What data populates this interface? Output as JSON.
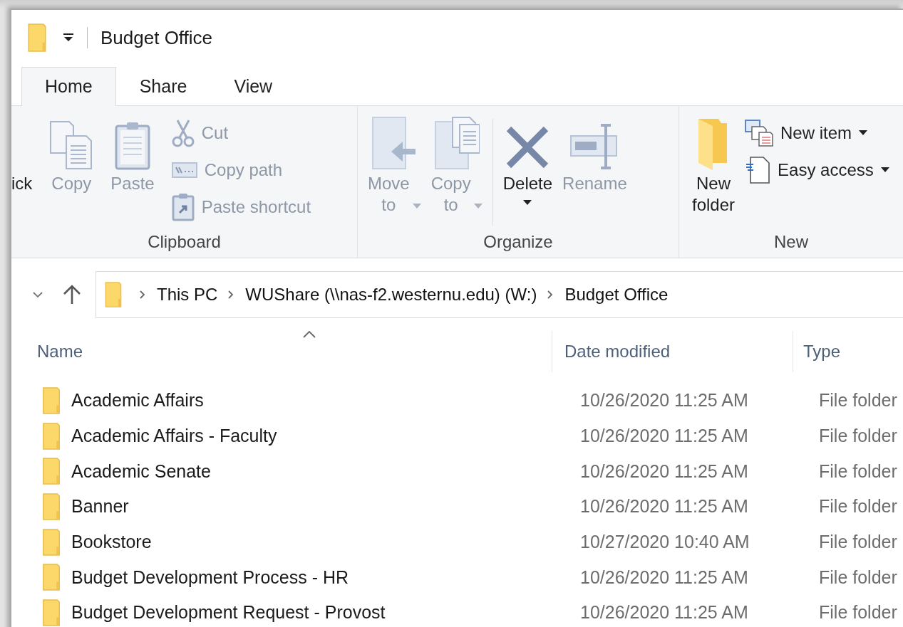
{
  "window": {
    "title": "Budget Office"
  },
  "tabs": [
    {
      "label": "Home",
      "selected": true
    },
    {
      "label": "Share",
      "selected": false
    },
    {
      "label": "View",
      "selected": false
    }
  ],
  "ribbon": {
    "groups": [
      {
        "label": "Clipboard",
        "items": [
          {
            "kind": "partial",
            "label": "ick",
            "disabled": false
          },
          {
            "kind": "large",
            "label": "Copy",
            "disabled": true,
            "dropdown": false
          },
          {
            "kind": "large",
            "label": "Paste",
            "disabled": true,
            "dropdown": false
          },
          {
            "kind": "small",
            "label": "Cut",
            "disabled": true,
            "dropdown": false
          },
          {
            "kind": "small",
            "label": "Copy path",
            "disabled": true,
            "dropdown": false
          },
          {
            "kind": "small",
            "label": "Paste shortcut",
            "disabled": true,
            "dropdown": false
          }
        ]
      },
      {
        "label": "Organize",
        "items": [
          {
            "kind": "large",
            "label": "Move to",
            "disabled": true,
            "dropdown": true
          },
          {
            "kind": "large",
            "label": "Copy to",
            "disabled": true,
            "dropdown": true
          },
          {
            "kind": "separator"
          },
          {
            "kind": "split",
            "label": "Delete",
            "disabled": false,
            "dropdown": true
          },
          {
            "kind": "large",
            "label": "Rename",
            "disabled": true,
            "dropdown": false
          }
        ]
      },
      {
        "label": "New",
        "items": [
          {
            "kind": "large",
            "label": "New folder",
            "disabled": false,
            "dropdown": false
          },
          {
            "kind": "small",
            "label": "New item",
            "disabled": false,
            "dropdown": true
          },
          {
            "kind": "small",
            "label": "Easy access",
            "disabled": false,
            "dropdown": true
          }
        ]
      }
    ]
  },
  "address_bar": {
    "segments": [
      "This PC",
      "WUShare (\\\\nas-f2.westernu.edu) (W:)",
      "Budget Office"
    ]
  },
  "file_list": {
    "sorted_ascending": true,
    "columns": [
      {
        "label": "Name"
      },
      {
        "label": "Date modified"
      },
      {
        "label": "Type"
      }
    ],
    "rows": [
      {
        "name": "Academic Affairs",
        "date_modified": "10/26/2020 11:25 AM",
        "type": "File folder"
      },
      {
        "name": "Academic Affairs - Faculty",
        "date_modified": "10/26/2020 11:25 AM",
        "type": "File folder"
      },
      {
        "name": "Academic Senate",
        "date_modified": "10/26/2020 11:25 AM",
        "type": "File folder"
      },
      {
        "name": "Banner",
        "date_modified": "10/26/2020 11:25 AM",
        "type": "File folder"
      },
      {
        "name": "Bookstore",
        "date_modified": "10/27/2020 10:40 AM",
        "type": "File folder"
      },
      {
        "name": "Budget Development Process - HR",
        "date_modified": "10/26/2020 11:25 AM",
        "type": "File folder"
      },
      {
        "name": "Budget Development Request - Provost",
        "date_modified": "10/26/2020 11:25 AM",
        "type": "File folder"
      }
    ]
  }
}
